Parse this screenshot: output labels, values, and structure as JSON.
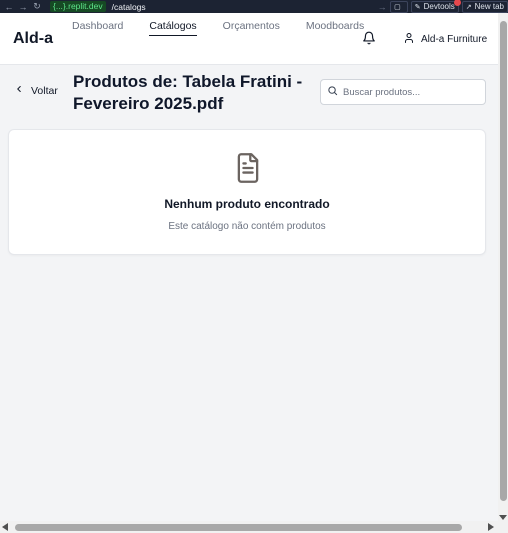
{
  "browser": {
    "url_host": "{...}.replit.dev",
    "url_path": "/catalogs",
    "devtools_label": "Devtools",
    "new_tab_label": "New tab"
  },
  "header": {
    "logo": "Ald-a",
    "nav": [
      {
        "label": "Dashboard",
        "active": false
      },
      {
        "label": "Catálogos",
        "active": true
      },
      {
        "label": "Orçamentos",
        "active": false
      },
      {
        "label": "Moodboards",
        "active": false
      }
    ],
    "account_name": "Ald-a Furniture"
  },
  "main": {
    "back_label": "Voltar",
    "title": "Produtos de: Tabela Fratini - Fevereiro 2025.pdf",
    "search_placeholder": "Buscar produtos...",
    "empty_title": "Nenhum produto encontrado",
    "empty_subtitle": "Este catálogo não contém produtos"
  },
  "icons": {
    "back": "chevron-left-icon",
    "search": "search-icon",
    "bell": "bell-icon",
    "user": "user-icon",
    "document": "file-text-icon"
  },
  "colors": {
    "page_background": "#f3f4f6",
    "browser_bar": "#1c2333",
    "url_highlight": "#5ee38a"
  }
}
